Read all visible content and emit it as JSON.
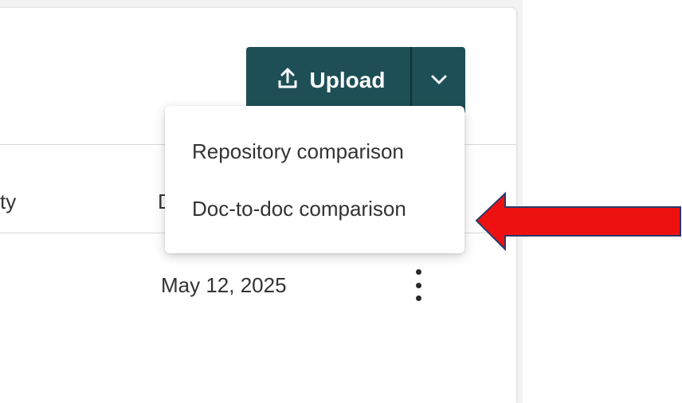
{
  "toolbar": {
    "upload_label": "Upload",
    "upload_icon": "upload-icon",
    "dropdown_icon": "chevron-down-icon",
    "accent_color": "#1e4f56"
  },
  "table": {
    "headers": [
      "ty",
      "D"
    ],
    "rows": [
      {
        "date": "May 12, 2025",
        "actions_icon": "more-vertical-icon"
      }
    ]
  },
  "dropdown_menu": {
    "items": [
      {
        "label": "Repository comparison"
      },
      {
        "label": "Doc-to-doc comparison"
      }
    ]
  },
  "annotation": {
    "arrow_color": "#ee1111",
    "arrow_points_to": "Doc-to-doc comparison"
  }
}
